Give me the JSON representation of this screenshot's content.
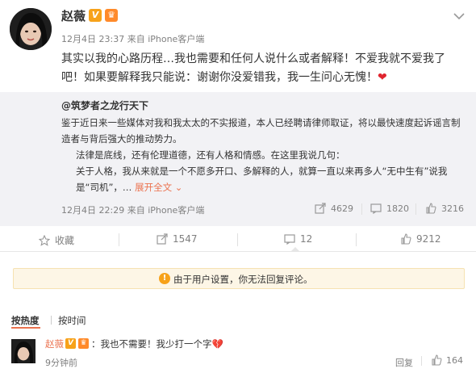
{
  "post": {
    "author": "赵薇",
    "verified_badge": "V",
    "member_badge": "♛",
    "date": "12月4日 23:37",
    "source": "来自 iPhone客户端",
    "text": "其实以我的心路历程…我也需要和任何人说什么或者解释！不爱我就不爱我了吧！如果要解释我只能说：谢谢你没爱错我，我一生问心无愧！",
    "emoji": "❤"
  },
  "repost": {
    "author": "@筑梦者之龙行天下",
    "lines": [
      "鉴于近日来一些媒体对我和我太太的不实报道，本人已经聘请律师取证，将以最快速度起诉谣言制造者与背后强大的推动势力。",
      "法律是底线，还有伦理道德，还有人格和情感。在这里我说几句：",
      "关于人格，我从来就是一个不愿多开口、多解释的人，就算一直以来再多人“无中生有”说我是“司机”，…"
    ],
    "expand_label": "展开全文",
    "date": "12月4日 22:29",
    "source": "来自 iPhone客户端",
    "reposts": "4629",
    "comments": "1820",
    "likes": "3216"
  },
  "actions": {
    "favorite": "收藏",
    "repost": "1547",
    "comment": "12",
    "like": "9212"
  },
  "notice": "由于用户设置，你无法回复评论。",
  "sort": {
    "hot": "按热度",
    "time": "按时间"
  },
  "comment": {
    "author": "赵薇",
    "text": "：我也不需要！我少打一个字",
    "emoji": "💔",
    "time": "9分钟前",
    "reply": "回复",
    "likes": "164"
  },
  "colors": {
    "accent": "#eb7350",
    "gray_text": "#808080",
    "repost_bg": "#f2f2f5",
    "notice_bg": "#fdf6e6"
  }
}
